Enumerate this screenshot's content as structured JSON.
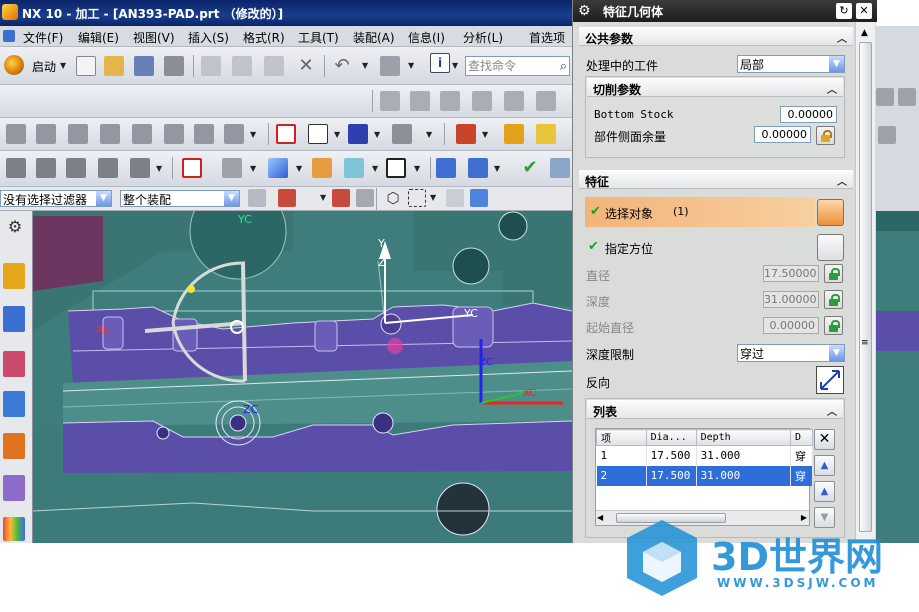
{
  "window": {
    "title": "NX 10 - 加工 - [AN393-PAD.prt （修改的）]"
  },
  "menubar": {
    "items": [
      "文件(F)",
      "编辑(E)",
      "视图(V)",
      "插入(S)",
      "格式(R)",
      "工具(T)",
      "装配(A)",
      "信息(I)",
      "分析(L)",
      "首选项"
    ]
  },
  "toolbar": {
    "start_label": "启动",
    "search_placeholder": "查找命令"
  },
  "filterbar": {
    "filter_value": "没有选择过滤器",
    "assembly_value": "整个装配"
  },
  "viewport": {
    "labels": {
      "xc_left": "XC",
      "zc_axis": "ZC",
      "yc_top": "YC",
      "z_axis": "Z",
      "y_axis": "Y",
      "yc_right": "YC",
      "zc_right": "ZC",
      "xc_right": "XC"
    }
  },
  "dialog": {
    "title": "特征几何体",
    "common_params": {
      "header": "公共参数",
      "in_process_label": "处理中的工件",
      "in_process_value": "局部",
      "cut_params": {
        "header": "切削参数",
        "bottom_stock_label": "Bottom Stock",
        "bottom_stock_value": "0.00000",
        "side_stock_label": "部件侧面余量",
        "side_stock_value": "0.00000"
      }
    },
    "feature": {
      "header": "特征",
      "select_object_label": "选择对象",
      "select_object_count": "(1)",
      "orientation_label": "指定方位",
      "diameter_label": "直径",
      "diameter_value": "17.50000",
      "depth_label": "深度",
      "depth_value": "31.00000",
      "start_diameter_label": "起始直径",
      "start_diameter_value": "0.00000",
      "depth_limit_label": "深度限制",
      "depth_limit_value": "穿过",
      "reverse_label": "反向"
    },
    "list": {
      "header": "列表",
      "columns": [
        "项",
        "Dia...",
        "Depth",
        "D"
      ],
      "rows": [
        {
          "item": "1",
          "dia": "17.500",
          "depth": "31.000",
          "d": "穿"
        },
        {
          "item": "2",
          "dia": "17.500",
          "depth": "31.000",
          "d": "穿"
        }
      ]
    }
  },
  "watermark": {
    "title": "3D世界网",
    "url": "WWW.3DSJW.COM"
  },
  "colors": {
    "title_bar": "#0a246a",
    "viewport_bg": "#3f7d7c",
    "part_purple": "#5a4ea8",
    "selected_row": "#2e6ed8",
    "select_object_highlight": "#f2b47a",
    "watermark": "#1f8fd6"
  }
}
